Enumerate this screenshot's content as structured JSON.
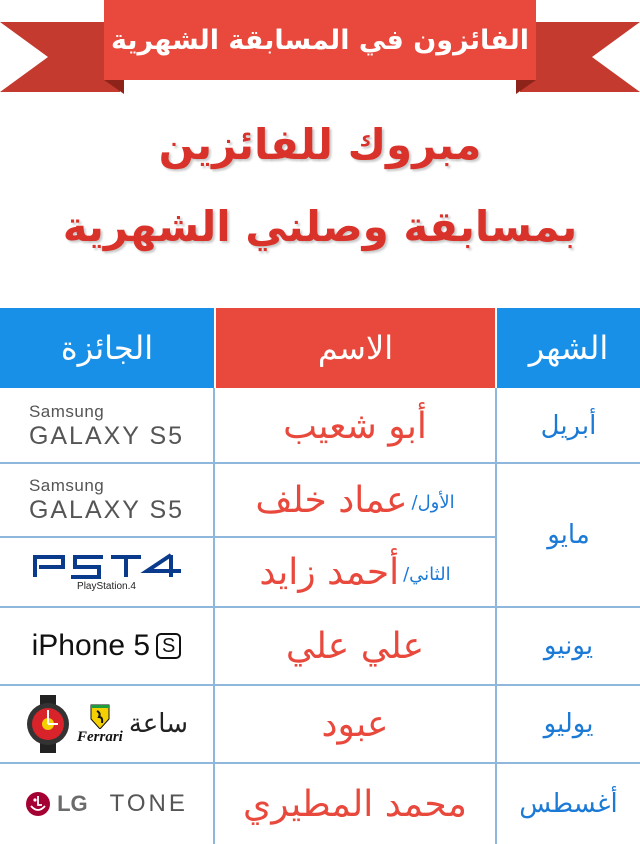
{
  "banner": {
    "title": "الفائزون في المسابقة الشهرية",
    "ribbon_color": "#e8493c"
  },
  "headline": {
    "line1": "مبروك للفائزين",
    "line2": "بمسابقة وصلني الشهرية",
    "color": "#d9322a"
  },
  "table": {
    "headers": {
      "month": "الشهر",
      "name": "الاسم",
      "prize": "الجائزة"
    },
    "header_colors": {
      "month": "#1990e8",
      "name": "#e8493c",
      "prize": "#1990e8"
    },
    "months": [
      "أبريل",
      "مايو",
      "يونيو",
      "يوليو",
      "أغسطس"
    ],
    "rows": [
      {
        "name": "أبو شعيب",
        "rank": ""
      },
      {
        "name": "عماد خلف",
        "rank": "الأول/"
      },
      {
        "name": "أحمد زايد",
        "rank": "الثاني/"
      },
      {
        "name": "علي علي",
        "rank": ""
      },
      {
        "name": "عبود",
        "rank": ""
      },
      {
        "name": "محمد المطيري",
        "rank": ""
      }
    ],
    "prizes": {
      "galaxy": {
        "brand": "Samsung",
        "model": "GALAXY S5",
        "icon": "samsung-galaxy-s5-logo"
      },
      "ps4": {
        "label": "PlayStation.4",
        "icon": "ps4-logo"
      },
      "iphone": {
        "text": "iPhone 5",
        "suffix": "S"
      },
      "watch": {
        "label": "ساعة",
        "brand": "Ferrari",
        "icon": "ferrari-watch-icon"
      },
      "lgtone": {
        "lg": "LG",
        "tone": "TONE",
        "icon": "lg-logo"
      }
    }
  }
}
